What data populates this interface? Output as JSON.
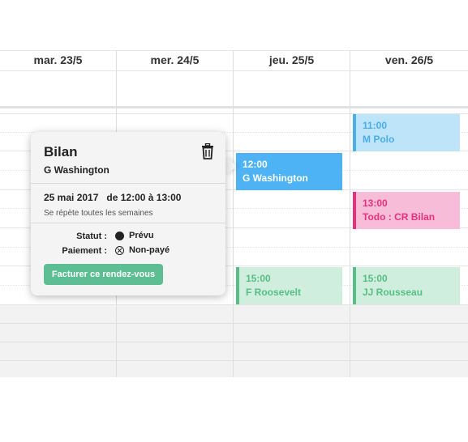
{
  "days": [
    "mar. 23/5",
    "mer. 24/5",
    "jeu. 25/5",
    "ven. 26/5"
  ],
  "events": [
    {
      "time": "11:00",
      "title": "M Polo",
      "day": "ven. 26/5",
      "color": "#bde4f8",
      "accent": "#4aaee9"
    },
    {
      "time": "12:00",
      "title": "G Washington",
      "day": "jeu. 25/5",
      "color": "#4db3f5",
      "accent": "#ffffff"
    },
    {
      "time": "13:00",
      "title": "Todo : CR Bilan",
      "day": "ven. 26/5",
      "color": "#f6bcd8",
      "accent": "#e8317d"
    },
    {
      "time": "15:00",
      "title": "F Roosevelt",
      "day": "jeu. 25/5",
      "color": "#cfeedd",
      "accent": "#57be85"
    },
    {
      "time": "15:00",
      "title": "JJ Rousseau",
      "day": "ven. 26/5",
      "color": "#cfeedd",
      "accent": "#57be85"
    }
  ],
  "popup": {
    "title": "Bilan",
    "client": "G Washington",
    "date": "25 mai 2017",
    "time_range": "de 12:00 à 13:00",
    "repeat": "Se répète toutes les semaines",
    "status_label": "Statut :",
    "status_value": "Prévu",
    "payment_label": "Paiement :",
    "payment_value": "Non-payé",
    "bill_button": "Facturer ce rendez-vous"
  },
  "icons": {
    "delete": "trash-icon",
    "status": "filled-circle-icon",
    "payment": "x-circle-icon"
  },
  "colors": {
    "bill_button": "#5cbe92"
  }
}
